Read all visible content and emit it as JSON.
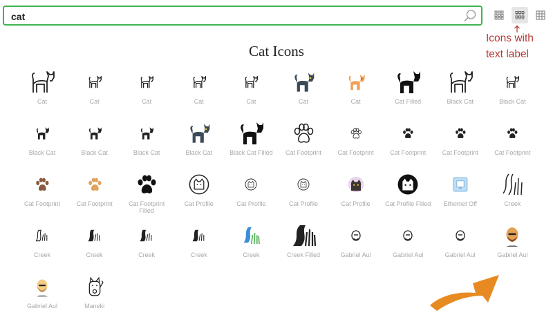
{
  "search": {
    "value": "cat",
    "icon": "search-icon"
  },
  "view_modes": [
    {
      "name": "view-small-grid",
      "icon": "small-grid-icon",
      "active": false
    },
    {
      "name": "view-icons-with-text",
      "icon": "icons-with-text-icon",
      "active": true
    },
    {
      "name": "view-large-grid",
      "icon": "large-grid-icon",
      "active": false
    }
  ],
  "annotation": {
    "line1": "Icons with",
    "line2": "text label",
    "color": "#b33a3a"
  },
  "page_title": "Cat Icons",
  "accent": {
    "search_border": "#3fb34f",
    "arrow": "#e88a22"
  },
  "icons": [
    {
      "label": "Cat",
      "style": "outline"
    },
    {
      "label": "Cat",
      "style": "outline-small"
    },
    {
      "label": "Cat",
      "style": "outline-small"
    },
    {
      "label": "Cat",
      "style": "outline-small"
    },
    {
      "label": "Cat",
      "style": "outline-small"
    },
    {
      "label": "Cat",
      "style": "color-dark"
    },
    {
      "label": "Cat",
      "style": "color-orange"
    },
    {
      "label": "Cat Filled",
      "style": "filled"
    },
    {
      "label": "Black Cat",
      "style": "outline"
    },
    {
      "label": "Black Cat",
      "style": "outline-small"
    },
    {
      "label": "Black Cat",
      "style": "filled-small"
    },
    {
      "label": "Black Cat",
      "style": "filled-small"
    },
    {
      "label": "Black Cat",
      "style": "filled-small"
    },
    {
      "label": "Black Cat",
      "style": "color-dark"
    },
    {
      "label": "Black Cat Filled",
      "style": "filled"
    },
    {
      "label": "Cat Footprint",
      "style": "paw-outline"
    },
    {
      "label": "Cat Footprint",
      "style": "paw-outline-small"
    },
    {
      "label": "Cat Footprint",
      "style": "paw-small"
    },
    {
      "label": "Cat Footprint",
      "style": "paw-small"
    },
    {
      "label": "Cat Footprint",
      "style": "paw-small"
    },
    {
      "label": "Cat Footprint",
      "style": "paw-brown"
    },
    {
      "label": "Cat Footprint",
      "style": "paw-tan"
    },
    {
      "label": "Cat Footprint Filled",
      "style": "paw-filled"
    },
    {
      "label": "Cat Profile",
      "style": "profile-outline"
    },
    {
      "label": "Cat Profile",
      "style": "profile-small"
    },
    {
      "label": "Cat Profile",
      "style": "profile-small"
    },
    {
      "label": "Cat Profile",
      "style": "profile-color"
    },
    {
      "label": "Cat Profile Filled",
      "style": "profile-filled"
    },
    {
      "label": "Ethernet Off",
      "style": "ethernet"
    },
    {
      "label": "Creek",
      "style": "creek-outline"
    },
    {
      "label": "Creek",
      "style": "creek-small"
    },
    {
      "label": "Creek",
      "style": "creek-small-filled"
    },
    {
      "label": "Creek",
      "style": "creek-small-filled"
    },
    {
      "label": "Creek",
      "style": "creek-small-filled"
    },
    {
      "label": "Creek",
      "style": "creek-color"
    },
    {
      "label": "Creek Filled",
      "style": "creek-filled"
    },
    {
      "label": "Gabriel Aul",
      "style": "face-small"
    },
    {
      "label": "Gabriel Aul",
      "style": "face-small"
    },
    {
      "label": "Gabriel Aul",
      "style": "face-small"
    },
    {
      "label": "Gabriel Aul",
      "style": "face-color-dark"
    },
    {
      "label": "Gabriel Aul",
      "style": "face-color-light"
    },
    {
      "label": "Maneki",
      "style": "maneki"
    }
  ]
}
